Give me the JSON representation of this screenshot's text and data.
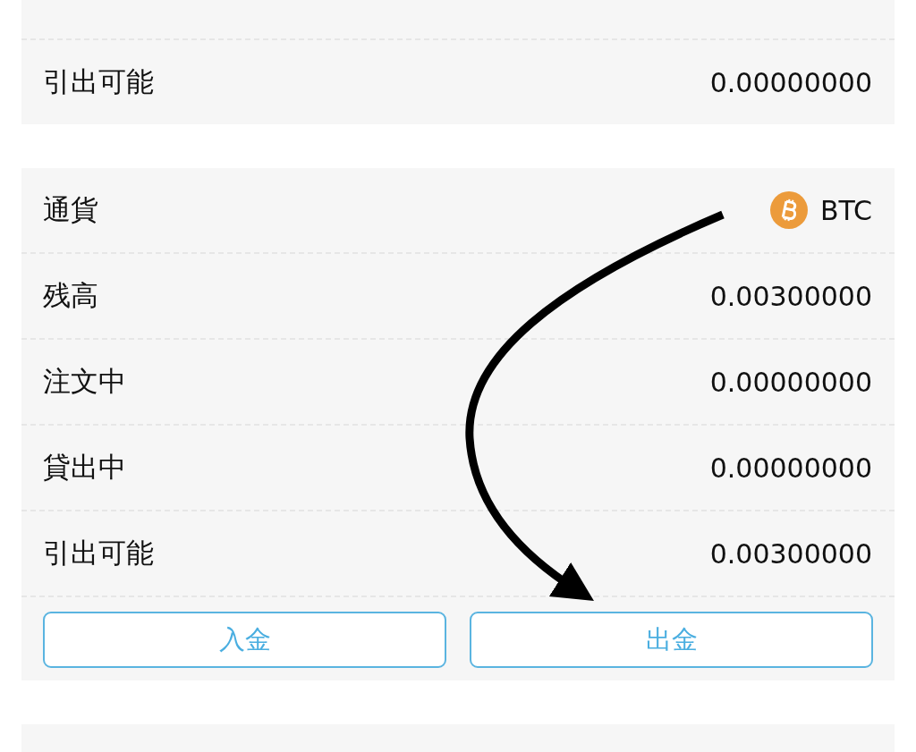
{
  "upper_card": {
    "rows": [
      {
        "label": "引出可能",
        "value": "0.00000000"
      }
    ]
  },
  "btc_card": {
    "currency_label": "通貨",
    "currency": "BTC",
    "rows": [
      {
        "label": "残高",
        "value": "0.00300000"
      },
      {
        "label": "注文中",
        "value": "0.00000000"
      },
      {
        "label": "貸出中",
        "value": "0.00000000"
      },
      {
        "label": "引出可能",
        "value": "0.00300000"
      }
    ],
    "buttons": [
      "入金",
      "出金"
    ]
  }
}
